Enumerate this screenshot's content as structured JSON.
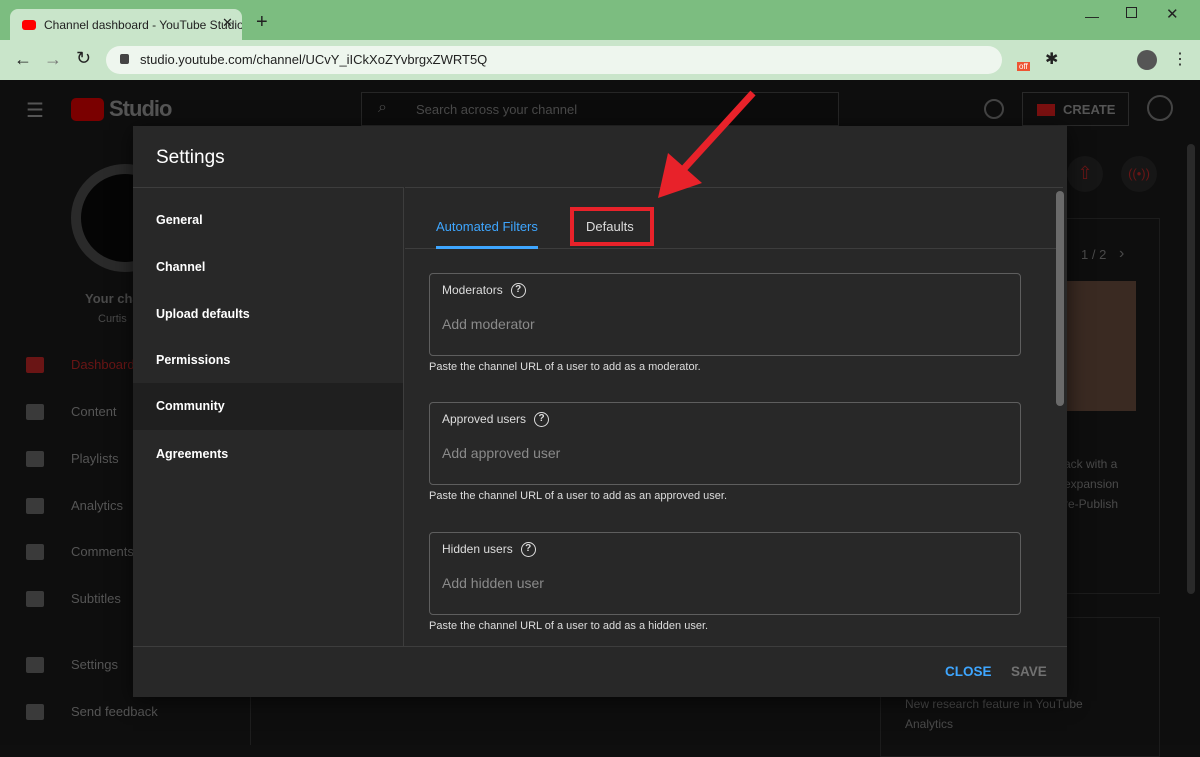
{
  "browser": {
    "tab_title": "Channel dashboard - YouTube Studio",
    "url": "studio.youtube.com/channel/UCvY_iICkXoZYvbrgxZWRT5Q",
    "extension_badge": "off"
  },
  "header": {
    "logo": "Studio",
    "search_placeholder": "Search across your channel",
    "create_label": "CREATE"
  },
  "sidebar": {
    "channel_name": "Your channel",
    "channel_owner": "Curtis",
    "items": [
      {
        "label": "Dashboard"
      },
      {
        "label": "Content"
      },
      {
        "label": "Playlists"
      },
      {
        "label": "Analytics"
      },
      {
        "label": "Comments"
      },
      {
        "label": "Subtitles"
      },
      {
        "label": "Settings"
      },
      {
        "label": "Send feedback"
      }
    ]
  },
  "background": {
    "pager": "1 / 2",
    "snippet": [
      "ack with a",
      "expansion",
      "re-Publish"
    ],
    "news": "New research feature in YouTube Analytics"
  },
  "dialog": {
    "title": "Settings",
    "nav": [
      {
        "label": "General"
      },
      {
        "label": "Channel"
      },
      {
        "label": "Upload defaults"
      },
      {
        "label": "Permissions"
      },
      {
        "label": "Community"
      },
      {
        "label": "Agreements"
      }
    ],
    "selected_nav": "Community",
    "tabs": [
      {
        "label": "Automated Filters"
      },
      {
        "label": "Defaults"
      }
    ],
    "active_tab": "Automated Filters",
    "fields": [
      {
        "label": "Moderators",
        "placeholder": "Add moderator",
        "help": "Paste the channel URL of a user to add as a moderator."
      },
      {
        "label": "Approved users",
        "placeholder": "Add approved user",
        "help": "Paste the channel URL of a user to add as an approved user."
      },
      {
        "label": "Hidden users",
        "placeholder": "Add hidden user",
        "help": "Paste the channel URL of a user to add as a hidden user."
      }
    ],
    "close_label": "CLOSE",
    "save_label": "SAVE"
  },
  "colors": {
    "accent": "#3ea6ff",
    "annotation": "#e8222a",
    "youtube_red": "#ff0000"
  }
}
